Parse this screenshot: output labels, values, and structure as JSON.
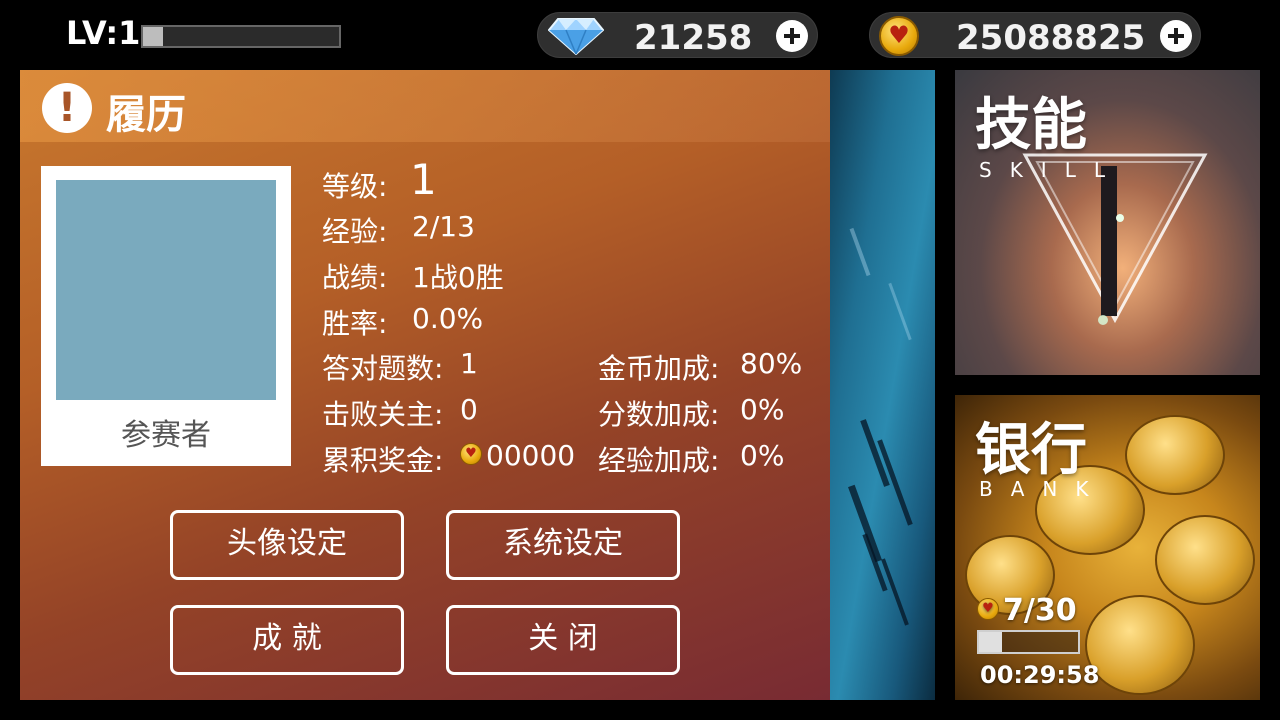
{
  "topbar": {
    "level_label": "LV:1",
    "level_progress": 0.1,
    "diamonds": "21258",
    "coins": "25088825",
    "diamond_icon": "diamond-icon",
    "coin_icon": "heart-coin-icon",
    "add_icon": "plus-icon"
  },
  "profile": {
    "title": "履历",
    "title_icon": "exclamation-icon",
    "avatar_label": "参赛者",
    "stats": {
      "level_label": "等级:",
      "level_value": "1",
      "exp_label": "经验:",
      "exp_value": "2/13",
      "record_label": "战绩:",
      "record_value": "1战0胜",
      "winrate_label": "胜率:",
      "winrate_value": "0.0%",
      "correct_label": "答对题数:",
      "correct_value": "1",
      "bosses_label": "击败关主:",
      "bosses_value": "0",
      "prize_label": "累积奖金:",
      "prize_value": "00000",
      "coin_bonus_label": "金币加成:",
      "coin_bonus_value": "80%",
      "score_bonus_label": "分数加成:",
      "score_bonus_value": "0%",
      "exp_bonus_label": "经验加成:",
      "exp_bonus_value": "0%"
    },
    "buttons": {
      "avatar_settings": "头像设定",
      "system_settings": "系统设定",
      "achievements": "成 就",
      "close": "关 闭"
    }
  },
  "skill_card": {
    "title": "技能",
    "subtitle": "SKILL"
  },
  "bank_card": {
    "title": "银行",
    "subtitle": "BANK",
    "count": "7/30",
    "progress": 0.23,
    "timer": "00:29:58"
  },
  "colors": {
    "panel_start": "#c8782e",
    "panel_end": "#782b33",
    "avatar_placeholder": "#7aaabe"
  }
}
